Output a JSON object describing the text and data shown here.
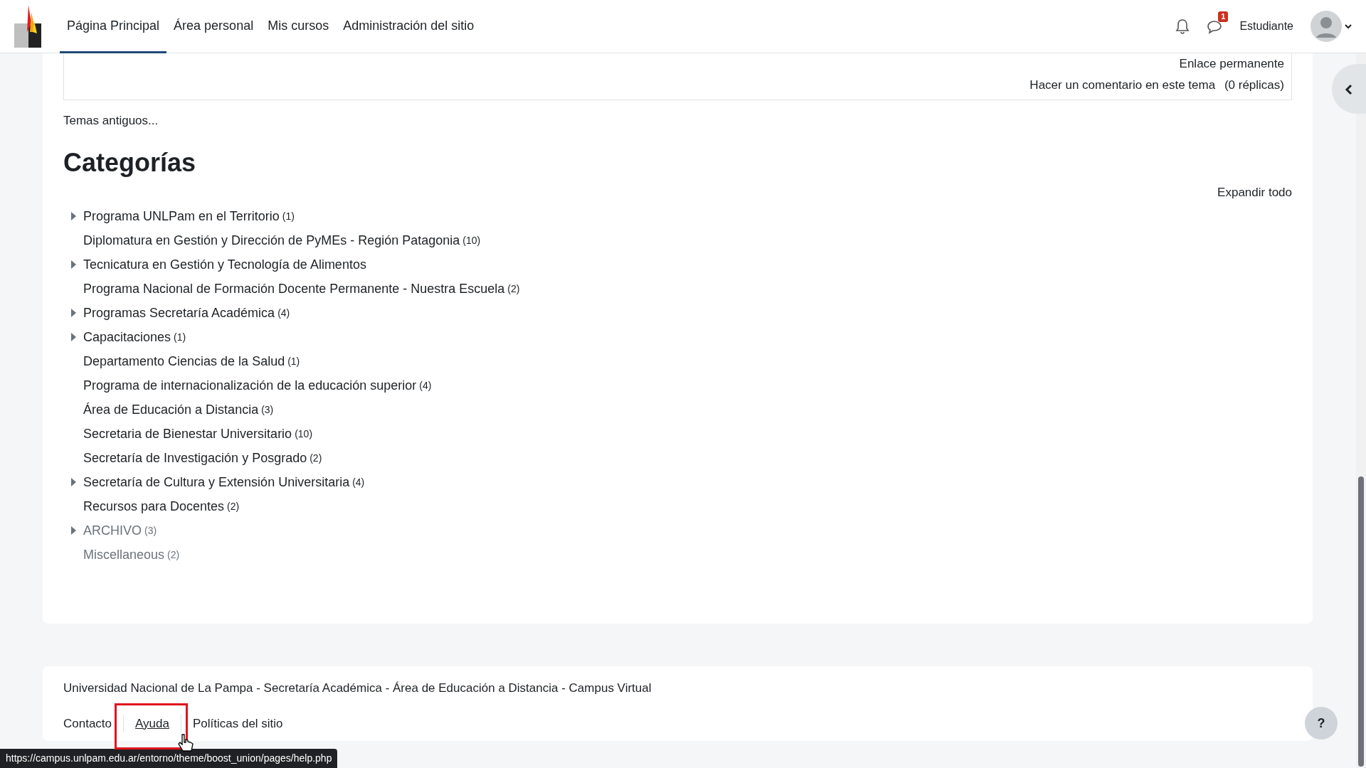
{
  "navbar": {
    "items": [
      {
        "label": "Página Principal",
        "selected": true
      },
      {
        "label": "Área personal",
        "selected": false
      },
      {
        "label": "Mis cursos",
        "selected": false
      },
      {
        "label": "Administración del sitio",
        "selected": false
      }
    ],
    "messages_badge": "1",
    "user_name": "Estudiante"
  },
  "forum_post": {
    "permalink": "Enlace permanente",
    "reply_link": "Hacer un comentario en este tema",
    "reply_count": "(0 réplicas)"
  },
  "older_topics": "Temas antiguos...",
  "categories": {
    "title": "Categorías",
    "expand_all": "Expandir todo",
    "items": [
      {
        "name": "Programa UNLPam en el Territorio",
        "count": "(1)",
        "has_children": true,
        "dimmed": false
      },
      {
        "name": "Diplomatura en Gestión y Dirección de PyMEs - Región Patagonia",
        "count": "(10)",
        "has_children": false,
        "dimmed": false
      },
      {
        "name": "Tecnicatura en Gestión y Tecnología de Alimentos",
        "has_children": true,
        "dimmed": false
      },
      {
        "name": "Programa Nacional de Formación Docente Permanente - Nuestra Escuela",
        "count": "(2)",
        "has_children": false,
        "dimmed": false
      },
      {
        "name": "Programas Secretaría Académica",
        "count": "(4)",
        "has_children": true,
        "dimmed": false
      },
      {
        "name": "Capacitaciones",
        "count": "(1)",
        "has_children": true,
        "dimmed": false
      },
      {
        "name": "Departamento Ciencias de la Salud",
        "count": "(1)",
        "has_children": false,
        "dimmed": false
      },
      {
        "name": "Programa de internacionalización de la educación superior",
        "count": "(4)",
        "has_children": false,
        "dimmed": false
      },
      {
        "name": "Área de Educación a Distancia",
        "count": "(3)",
        "has_children": false,
        "dimmed": false
      },
      {
        "name": "Secretaria de Bienestar Universitario",
        "count": "(10)",
        "has_children": false,
        "dimmed": false
      },
      {
        "name": "Secretaría de Investigación y Posgrado",
        "count": "(2)",
        "has_children": false,
        "dimmed": false
      },
      {
        "name": "Secretaría de Cultura y Extensión Universitaria",
        "count": "(4)",
        "has_children": true,
        "dimmed": false
      },
      {
        "name": "Recursos para Docentes",
        "count": "(2)",
        "has_children": false,
        "dimmed": false
      },
      {
        "name": "ARCHIVO",
        "count": "(3)",
        "has_children": true,
        "dimmed": true
      },
      {
        "name": "Miscellaneous",
        "count": "(2)",
        "has_children": false,
        "dimmed": true
      }
    ]
  },
  "footer": {
    "text": "Universidad Nacional de La Pampa - Secretaría Académica - Área de Educación a Distancia - Campus Virtual",
    "links": [
      {
        "label": "Contacto",
        "hovered": false
      },
      {
        "label": "Ayuda",
        "hovered": true
      },
      {
        "label": "Políticas del sitio",
        "hovered": false
      }
    ]
  },
  "status_bar": {
    "url": "https://campus.unlpam.edu.ar/entorno/theme/boost_union/pages/help.php"
  },
  "help_button": "?"
}
